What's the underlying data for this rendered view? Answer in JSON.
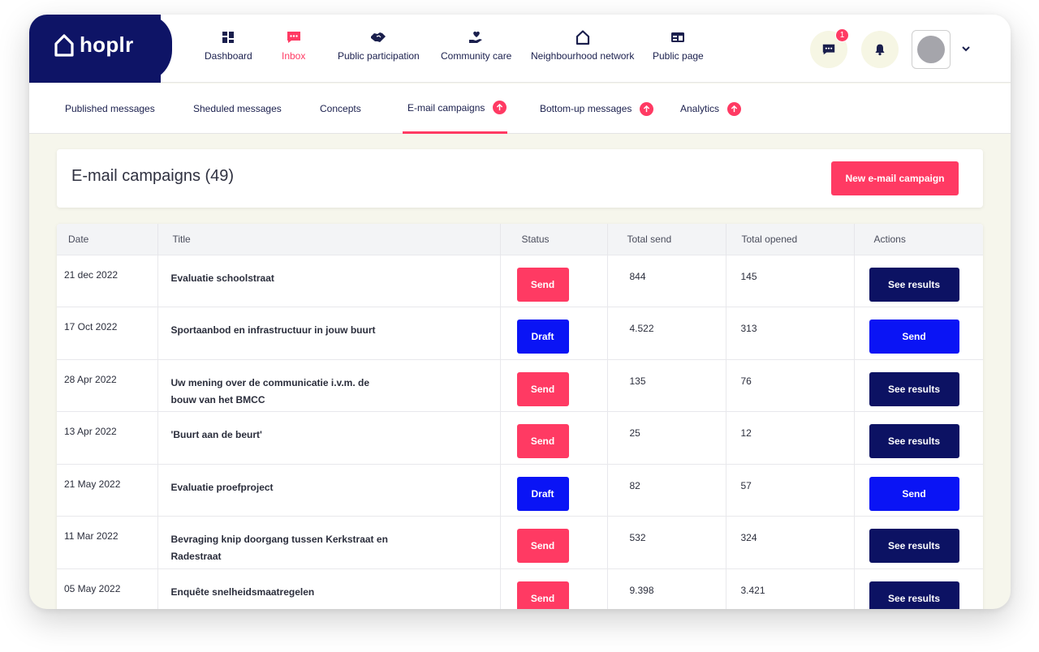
{
  "brand": {
    "name": "hoplr"
  },
  "colors": {
    "navy": "#0e1466",
    "accent": "#ff3a63",
    "blue": "#0a14f5",
    "dark_navy": "#0c1263"
  },
  "nav": [
    {
      "label": "Dashboard",
      "icon": "dashboard-icon"
    },
    {
      "label": "Inbox",
      "icon": "inbox-icon",
      "active": true
    },
    {
      "label": "Public participation",
      "icon": "handshake-icon"
    },
    {
      "label": "Community care",
      "icon": "heart-hand-icon"
    },
    {
      "label": "Neighbourhood network",
      "icon": "house-icon"
    },
    {
      "label": "Public page",
      "icon": "public-page-icon"
    }
  ],
  "header_actions": {
    "messages_badge": "1"
  },
  "subnav": [
    {
      "label": "Published messages"
    },
    {
      "label": "Sheduled messages"
    },
    {
      "label": "Concepts"
    },
    {
      "label": "E-mail campaigns",
      "active": true
    },
    {
      "label": "Bottom-up messages"
    },
    {
      "label": "Analytics"
    }
  ],
  "page": {
    "title": "E-mail campaigns (49)",
    "new_button": "New e-mail campaign"
  },
  "table": {
    "columns": [
      "Date",
      "Title",
      "Status",
      "Total send",
      "Total opened",
      "Actions"
    ],
    "rows": [
      {
        "date": "21 dec 2022",
        "title": "Evaluatie schoolstraat",
        "status": "Send",
        "total_send": "844",
        "total_opened": "145",
        "action": "See results"
      },
      {
        "date": "17 Oct 2022",
        "title": "Sportaanbod en infrastructuur in jouw buurt",
        "status": "Draft",
        "total_send": "4.522",
        "total_opened": "313",
        "action": "Send"
      },
      {
        "date": "28 Apr 2022",
        "title": "Uw mening over de communicatie i.v.m. de bouw van het BMCC",
        "status": "Send",
        "total_send": "135",
        "total_opened": "76",
        "action": "See results"
      },
      {
        "date": "13 Apr 2022",
        "title": "'Buurt aan de beurt'",
        "status": "Send",
        "total_send": "25",
        "total_opened": "12",
        "action": "See results"
      },
      {
        "date": "21 May 2022",
        "title": "Evaluatie proefproject",
        "status": "Draft",
        "total_send": "82",
        "total_opened": "57",
        "action": "Send"
      },
      {
        "date": "11 Mar 2022",
        "title": "Bevraging knip doorgang tussen Kerkstraat en Radestraat",
        "status": "Send",
        "total_send": "532",
        "total_opened": "324",
        "action": "See results"
      },
      {
        "date": "05 May 2022",
        "title": "Enquête snelheidsmaatregelen",
        "status": "Send",
        "total_send": "9.398",
        "total_opened": "3.421",
        "action": "See results"
      }
    ]
  }
}
